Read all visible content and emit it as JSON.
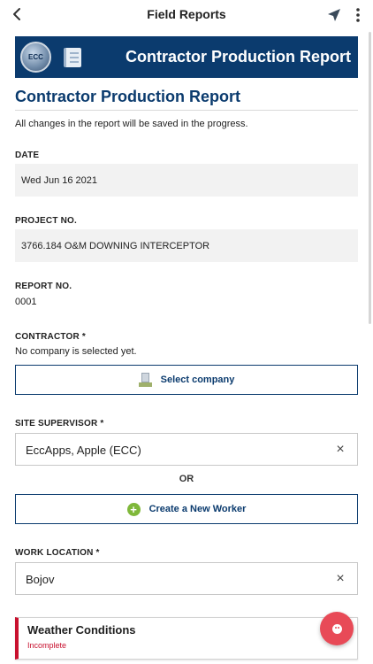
{
  "header": {
    "title": "Field Reports",
    "back_icon": "chevron-left-icon",
    "nav_icon": "navigation-arrow-icon",
    "more_icon": "more-vertical-icon"
  },
  "banner": {
    "logo_text": "ECC",
    "title": "Contractor Production Report"
  },
  "report": {
    "heading": "Contractor Production Report",
    "intro": "All changes in the report will be saved in the progress."
  },
  "fields": {
    "date_label": "DATE",
    "date_value": "Wed Jun 16 2021",
    "project_label": "PROJECT NO.",
    "project_value": "3766.184 O&M DOWNING INTERCEPTOR",
    "report_no_label": "REPORT NO.",
    "report_no_value": "0001",
    "contractor_label": "CONTRACTOR *",
    "contractor_value": "No company is selected yet.",
    "select_company_label": "Select company",
    "site_supervisor_label": "SITE SUPERVISOR *",
    "site_supervisor_value": "EccApps, Apple (ECC)",
    "or_label": "OR",
    "create_worker_label": "Create a New Worker",
    "work_location_label": "WORK LOCATION *",
    "work_location_value": "Bojov"
  },
  "sections": {
    "weather_title": "Weather Conditions",
    "weather_status": "Incomplete"
  },
  "colors": {
    "brand": "#0b3b6e",
    "status_incomplete": "#c8102e",
    "fab": "#e84a57",
    "add_green": "#7fb83a"
  }
}
